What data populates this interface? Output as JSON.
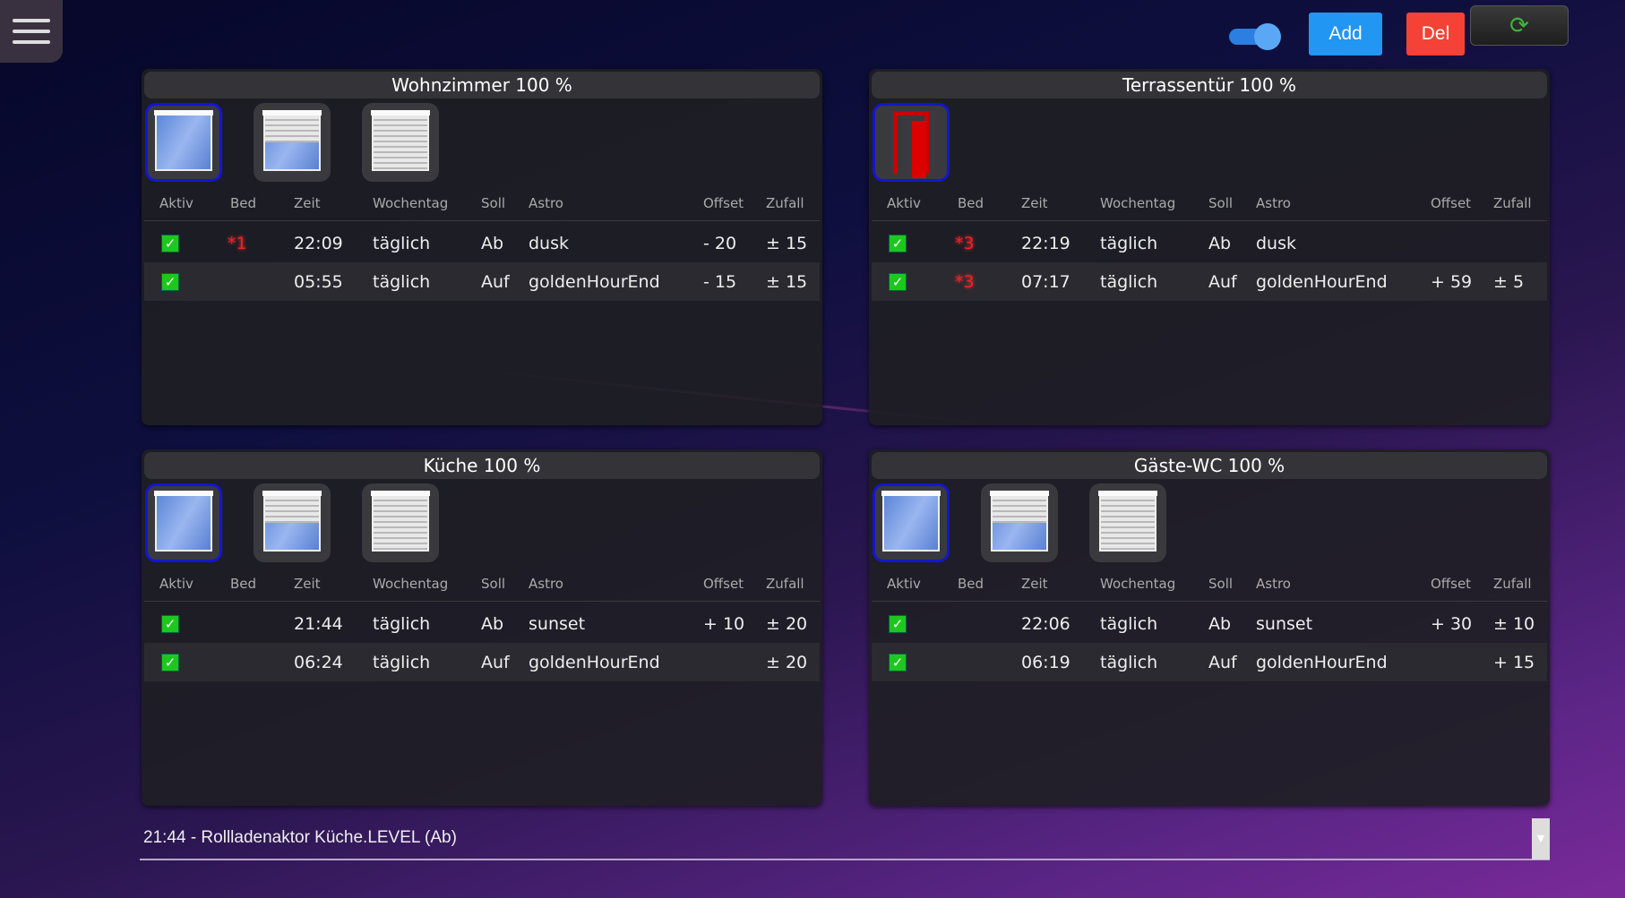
{
  "toolbar": {
    "add_label": "Add",
    "del_label": "Del",
    "refresh_icon": "refresh-icon",
    "toggle_on": true
  },
  "columns": [
    "Aktiv",
    "Bed",
    "Zeit",
    "Wochentag",
    "Soll",
    "Astro",
    "Offset",
    "Zufall"
  ],
  "panels": [
    {
      "title": "Wohnzimmer 100 %",
      "type": "window",
      "rows": [
        {
          "active": true,
          "bed": "*1",
          "zeit": "22:09",
          "tag": "täglich",
          "soll": "Ab",
          "astro": "dusk",
          "offset": "- 20",
          "zufall": "± 15"
        },
        {
          "active": true,
          "bed": "",
          "zeit": "05:55",
          "tag": "täglich",
          "soll": "Auf",
          "astro": "goldenHourEnd",
          "offset": "- 15",
          "zufall": "± 15"
        }
      ]
    },
    {
      "title": "Terrassentür 100 %",
      "type": "door",
      "rows": [
        {
          "active": true,
          "bed": "*3",
          "zeit": "22:19",
          "tag": "täglich",
          "soll": "Ab",
          "astro": "dusk",
          "offset": "",
          "zufall": ""
        },
        {
          "active": true,
          "bed": "*3",
          "zeit": "07:17",
          "tag": "täglich",
          "soll": "Auf",
          "astro": "goldenHourEnd",
          "offset": "+ 59",
          "zufall": "± 5"
        }
      ]
    },
    {
      "title": "Küche 100 %",
      "type": "window",
      "rows": [
        {
          "active": true,
          "bed": "",
          "zeit": "21:44",
          "tag": "täglich",
          "soll": "Ab",
          "astro": "sunset",
          "offset": "+ 10",
          "zufall": "± 20"
        },
        {
          "active": true,
          "bed": "",
          "zeit": "06:24",
          "tag": "täglich",
          "soll": "Auf",
          "astro": "goldenHourEnd",
          "offset": "",
          "zufall": "± 20"
        }
      ]
    },
    {
      "title": "Gäste-WC 100 %",
      "type": "window",
      "rows": [
        {
          "active": true,
          "bed": "",
          "zeit": "22:06",
          "tag": "täglich",
          "soll": "Ab",
          "astro": "sunset",
          "offset": "+ 30",
          "zufall": "± 10"
        },
        {
          "active": true,
          "bed": "",
          "zeit": "06:19",
          "tag": "täglich",
          "soll": "Auf",
          "astro": "goldenHourEnd",
          "offset": "",
          "zufall": "+ 15"
        }
      ]
    }
  ],
  "status": {
    "text": "21:44 - Rollladenaktor Küche.LEVEL (Ab)"
  },
  "colors": {
    "accent": "#2196f3",
    "danger": "#f44336",
    "check": "#1ec71e",
    "bed": "#e22222"
  }
}
